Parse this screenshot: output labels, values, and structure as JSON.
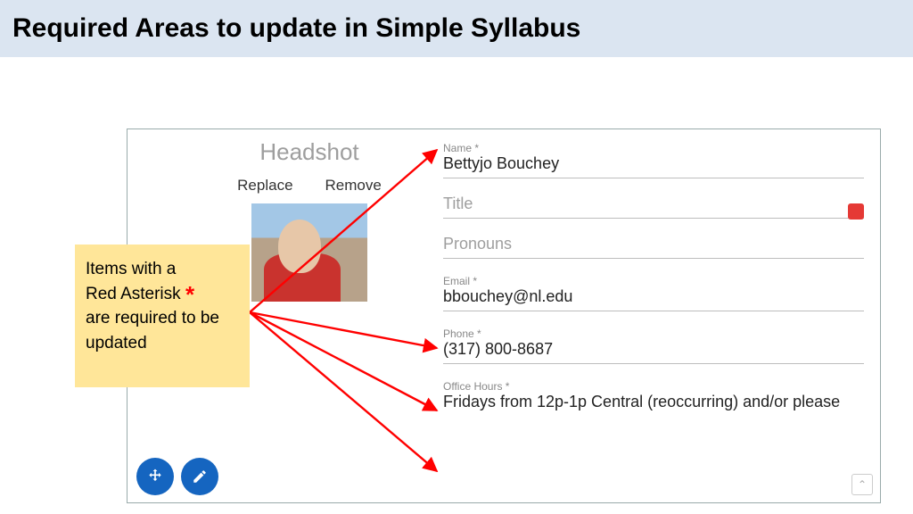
{
  "title": "Required Areas to update in Simple Syllabus",
  "callout": {
    "line1": "Items with a",
    "line2_prefix": "Red Asterisk ",
    "line3": "are required to be updated"
  },
  "headshot": {
    "heading": "Headshot",
    "replace": "Replace",
    "remove": "Remove"
  },
  "fields": {
    "name_label": "Name *",
    "name_value": "Bettyjo Bouchey",
    "title_label": "Title",
    "title_value": "",
    "pronouns_label": "Pronouns",
    "pronouns_value": "",
    "email_label": "Email *",
    "email_value": "bbouchey@nl.edu",
    "phone_label": "Phone *",
    "phone_value": "(317) 800-8687",
    "office_label": "Office Hours *",
    "office_value": "Fridays from 12p-1p Central (reoccurring) and/or please"
  }
}
